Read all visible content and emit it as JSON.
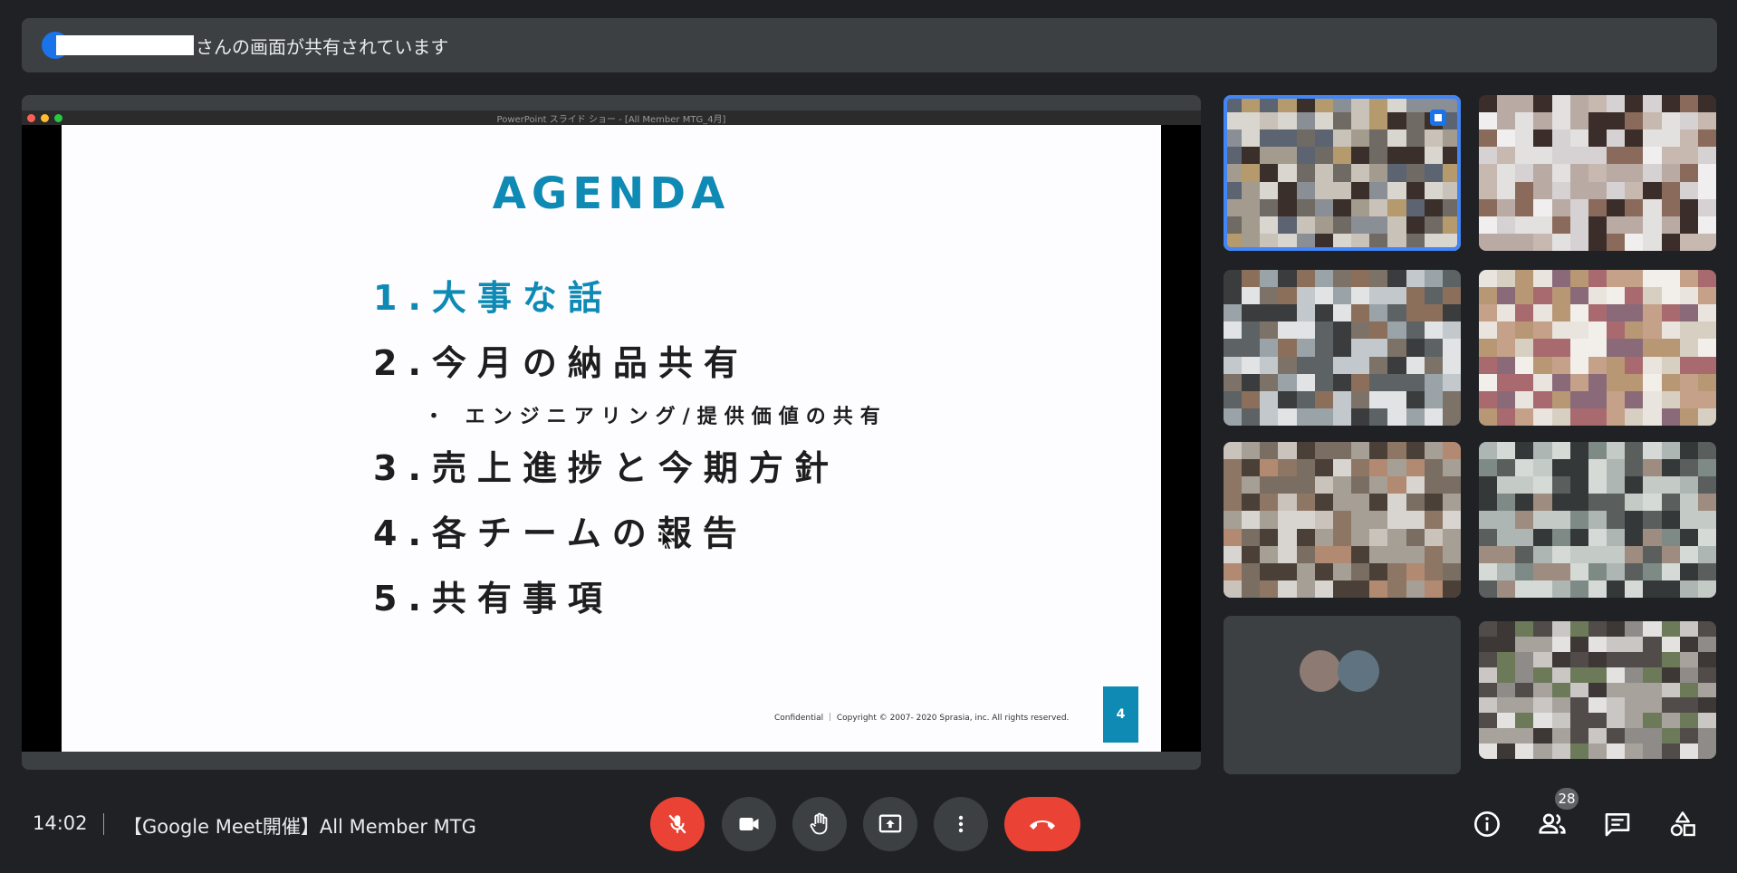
{
  "banner": {
    "message": "さんの画面が共有されています",
    "avatar_color": "#1a73e8"
  },
  "presentation": {
    "window_title": "PowerPoint スライド ショー - [All Member MTG_4月]",
    "slide": {
      "title": "AGENDA",
      "items": [
        "1.大事な話",
        "2.今月の納品共有",
        "・ エンジニアリング/提供価値の共有",
        "3.売上進捗と今期方針",
        "4.各チームの報告",
        "5.共有事項"
      ],
      "footer": "Confidential ｜ Copyright © 2007- 2020 Sprasia, inc. All rights reserved.",
      "page_number": "4",
      "accent_color": "#0e8ab5"
    }
  },
  "participants": {
    "count": "28",
    "active_outline_color": "#4285f4"
  },
  "bottom_bar": {
    "time": "14:02",
    "meeting_title": "【Google Meet開催】All Member MTG"
  },
  "icons": {
    "mic": "mic-off-icon",
    "camera": "videocam-icon",
    "hand": "raise-hand-icon",
    "present": "present-screen-icon",
    "more": "more-vert-icon",
    "hangup": "call-end-icon",
    "info": "info-icon",
    "people": "people-icon",
    "chat": "chat-icon",
    "activities": "activities-icon"
  }
}
